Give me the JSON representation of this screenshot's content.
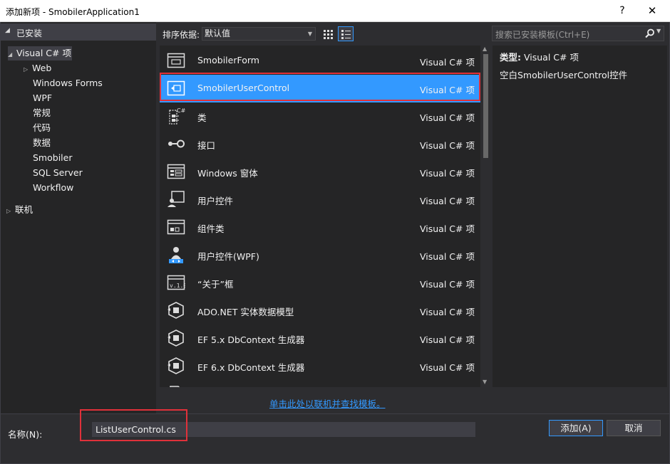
{
  "window": {
    "title": "添加新项 - SmobilerApplication1",
    "help_glyph": "?",
    "close_glyph": "✕"
  },
  "left": {
    "installed_label": "已安装",
    "tree": [
      {
        "label": "Visual C# 项"
      },
      {
        "label": "Web"
      },
      {
        "label": "Windows Forms"
      },
      {
        "label": "WPF"
      },
      {
        "label": "常规"
      },
      {
        "label": "代码"
      },
      {
        "label": "数据"
      },
      {
        "label": "Smobiler"
      },
      {
        "label": "SQL Server"
      },
      {
        "label": "Workflow"
      },
      {
        "label": "联机"
      }
    ]
  },
  "toolbar": {
    "sort_label": "排序依据:",
    "sort_value": "默认值"
  },
  "search": {
    "placeholder": "搜索已安装模板(Ctrl+E)"
  },
  "templates": [
    {
      "name": "SmobilerForm",
      "lang": "Visual C# 项",
      "icon": "form-icon"
    },
    {
      "name": "SmobilerUserControl",
      "lang": "Visual C# 项",
      "icon": "usercontrol-icon"
    },
    {
      "name": "类",
      "lang": "Visual C# 项",
      "icon": "class-icon"
    },
    {
      "name": "接口",
      "lang": "Visual C# 项",
      "icon": "interface-icon"
    },
    {
      "name": "Windows 窗体",
      "lang": "Visual C# 项",
      "icon": "windows-form-icon"
    },
    {
      "name": "用户控件",
      "lang": "Visual C# 项",
      "icon": "user-control-icon"
    },
    {
      "name": "组件类",
      "lang": "Visual C# 项",
      "icon": "component-icon"
    },
    {
      "name": "用户控件(WPF)",
      "lang": "Visual C# 项",
      "icon": "wpf-user-control-icon"
    },
    {
      "name": "“关于”框",
      "lang": "Visual C# 项",
      "icon": "about-box-icon"
    },
    {
      "name": "ADO.NET 实体数据模型",
      "lang": "Visual C# 项",
      "icon": "entity-model-icon"
    },
    {
      "name": "EF 5.x DbContext 生成器",
      "lang": "Visual C# 项",
      "icon": "dbcontext-icon"
    },
    {
      "name": "EF 6.x DbContext 生成器",
      "lang": "Visual C# 项",
      "icon": "dbcontext-icon"
    }
  ],
  "details": {
    "type_label": "类型:",
    "type_value": "Visual C# 项",
    "description": "空白SmobilerUserControl控件"
  },
  "online_link": "单击此处以联机并查找模板。",
  "bottom": {
    "name_label": "名称(N):",
    "name_value": "ListUserControl.cs",
    "add_label": "添加(A)",
    "cancel_label": "取消"
  },
  "colors": {
    "accent": "#3399ff",
    "highlight_outline": "#e0313a"
  }
}
